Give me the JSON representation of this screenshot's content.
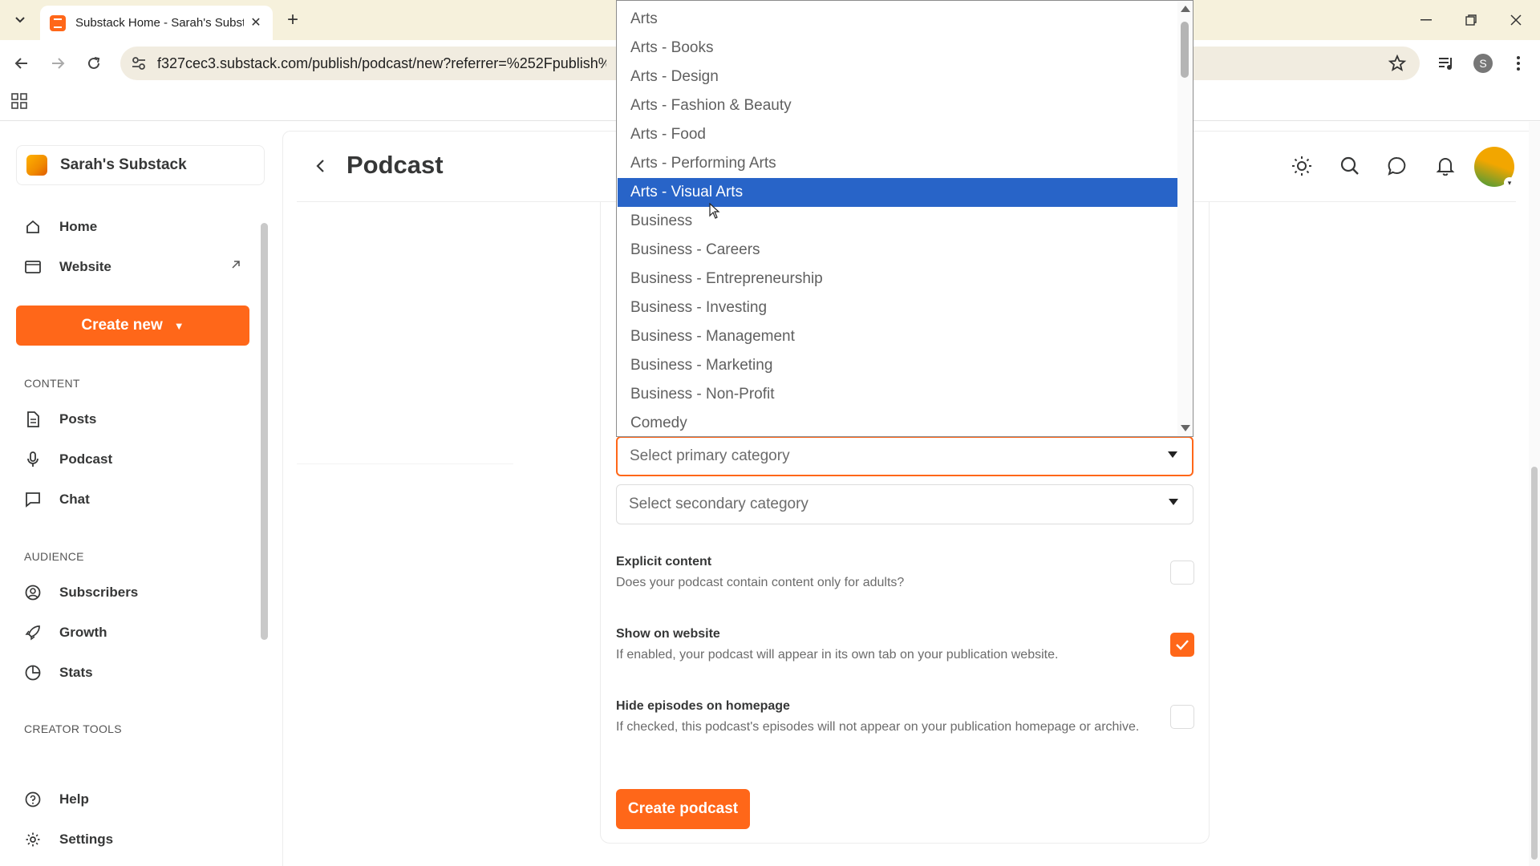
{
  "browser": {
    "tab_title": "Substack Home - Sarah's Substack",
    "url": "f327cec3.substack.com/publish/podcast/new?referrer=%252Fpublish%252",
    "profile_initial": "S"
  },
  "sidebar": {
    "publication_name": "Sarah's Substack",
    "top_items": [
      {
        "label": "Home"
      },
      {
        "label": "Website"
      }
    ],
    "create_new_label": "Create new",
    "sections": [
      {
        "label": "CONTENT",
        "items": [
          {
            "label": "Posts"
          },
          {
            "label": "Podcast"
          },
          {
            "label": "Chat"
          }
        ]
      },
      {
        "label": "AUDIENCE",
        "items": [
          {
            "label": "Subscribers"
          },
          {
            "label": "Growth"
          },
          {
            "label": "Stats"
          }
        ]
      },
      {
        "label": "CREATOR TOOLS",
        "items": []
      }
    ],
    "bottom_items": [
      {
        "label": "Help"
      },
      {
        "label": "Settings"
      }
    ]
  },
  "main": {
    "title": "Podcast",
    "primary_category_placeholder": "Select primary category",
    "secondary_category_placeholder": "Select secondary category",
    "options": [
      {
        "title": "Explicit content",
        "description": "Does your podcast contain content only for adults?",
        "checked": false
      },
      {
        "title": "Show on website",
        "description": "If enabled, your podcast will appear in its own tab on your publication website.",
        "checked": true
      },
      {
        "title": "Hide episodes on homepage",
        "description": "If checked, this podcast's episodes will not appear on your publication homepage or archive.",
        "checked": false
      }
    ],
    "create_button_label": "Create podcast"
  },
  "dropdown": {
    "selected": "Arts - Visual Arts",
    "items": [
      "Arts",
      "Arts - Books",
      "Arts - Design",
      "Arts - Fashion & Beauty",
      "Arts - Food",
      "Arts - Performing Arts",
      "Arts - Visual Arts",
      "Business",
      "Business - Careers",
      "Business - Entrepreneurship",
      "Business - Investing",
      "Business - Management",
      "Business - Marketing",
      "Business - Non-Profit",
      "Comedy"
    ]
  },
  "colors": {
    "brand": "#ff6719",
    "selection": "#2864c8",
    "chrome": "#f6f1dc"
  }
}
